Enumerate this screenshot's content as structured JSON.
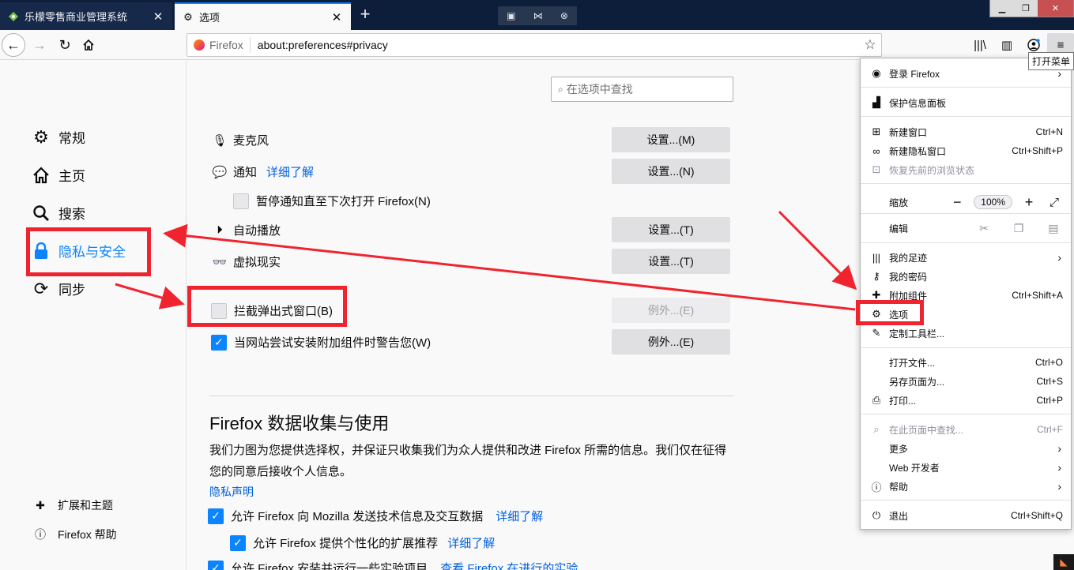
{
  "tabs": [
    {
      "title": "乐檬零售商业管理系统",
      "close": "✕"
    },
    {
      "title": "选项",
      "close": "✕"
    }
  ],
  "new_tab": "+",
  "window_controls": {
    "minimize": "▁",
    "restore": "❐",
    "close": "✕"
  },
  "urlbar": {
    "identity": "Firefox",
    "url": "about:preferences#privacy"
  },
  "tooltip": "打开菜单",
  "sidebar": {
    "categories": [
      {
        "label": "常规",
        "icon": "gear-icon"
      },
      {
        "label": "主页",
        "icon": "home-icon"
      },
      {
        "label": "搜索",
        "icon": "search-icon"
      },
      {
        "label": "隐私与安全",
        "icon": "lock-icon"
      },
      {
        "label": "同步",
        "icon": "sync-icon"
      }
    ],
    "footer": [
      {
        "label": "扩展和主题",
        "icon": "puzzle-icon"
      },
      {
        "label": "Firefox 帮助",
        "icon": "help-icon"
      }
    ]
  },
  "search": {
    "placeholder": "在选项中查找"
  },
  "permissions": [
    {
      "label": "麦克风",
      "button": "设置...(M)"
    },
    {
      "label": "通知",
      "link": "详细了解",
      "button": "设置...(N)"
    },
    {
      "label": "暂停通知直至下次打开 Firefox(N)"
    },
    {
      "label": "自动播放",
      "button": "设置...(T)"
    },
    {
      "label": "虚拟现实",
      "button": "设置...(T)"
    }
  ],
  "block_popups": {
    "label": "拦截弹出式窗口(B)",
    "checked": false,
    "button": "例外...(E)"
  },
  "warn_addons": {
    "label": "当网站尝试安装附加组件时警告您(W)",
    "checked": true,
    "button": "例外...(E)"
  },
  "data_collection": {
    "heading": "Firefox 数据收集与使用",
    "description": "我们力图为您提供选择权，并保证只收集我们为众人提供和改进 Firefox 所需的信息。我们仅在征得您的同意后接收个人信息。",
    "privacy_link": "隐私声明",
    "options": [
      {
        "label": "允许 Firefox 向 Mozilla 发送技术信息及交互数据",
        "link": "详细了解",
        "checked": true
      },
      {
        "label": "允许 Firefox 提供个性化的扩展推荐",
        "link": "详细了解",
        "checked": true
      },
      {
        "label": "允许 Firefox 安装并运行一些实验项目",
        "link": "查看 Firefox 在进行的实验",
        "checked": true
      }
    ]
  },
  "app_menu": {
    "sign_in": "登录 Firefox",
    "protections": "保护信息面板",
    "new_window": {
      "label": "新建窗口",
      "key": "Ctrl+N"
    },
    "new_private": {
      "label": "新建隐私窗口",
      "key": "Ctrl+Shift+P"
    },
    "restore": "恢复先前的浏览状态",
    "zoom": {
      "label": "缩放",
      "minus": "−",
      "value": "100%",
      "plus": "+",
      "fullscreen": "⤢"
    },
    "edit": "编辑",
    "library": "我的足迹",
    "logins": "我的密码",
    "addons": {
      "label": "附加组件",
      "key": "Ctrl+Shift+A"
    },
    "options": "选项",
    "customize": "定制工具栏...",
    "open_file": {
      "label": "打开文件...",
      "key": "Ctrl+O"
    },
    "save_page": {
      "label": "另存页面为...",
      "key": "Ctrl+S"
    },
    "print": {
      "label": "打印...",
      "key": "Ctrl+P"
    },
    "find": {
      "label": "在此页面中查找...",
      "key": "Ctrl+F"
    },
    "more": "更多",
    "web_dev": "Web 开发者",
    "help": "帮助",
    "quit": {
      "label": "退出",
      "key": "Ctrl+Shift+Q"
    }
  },
  "colors": {
    "accent": "#0a84ff",
    "annotation": "#f0242e"
  }
}
